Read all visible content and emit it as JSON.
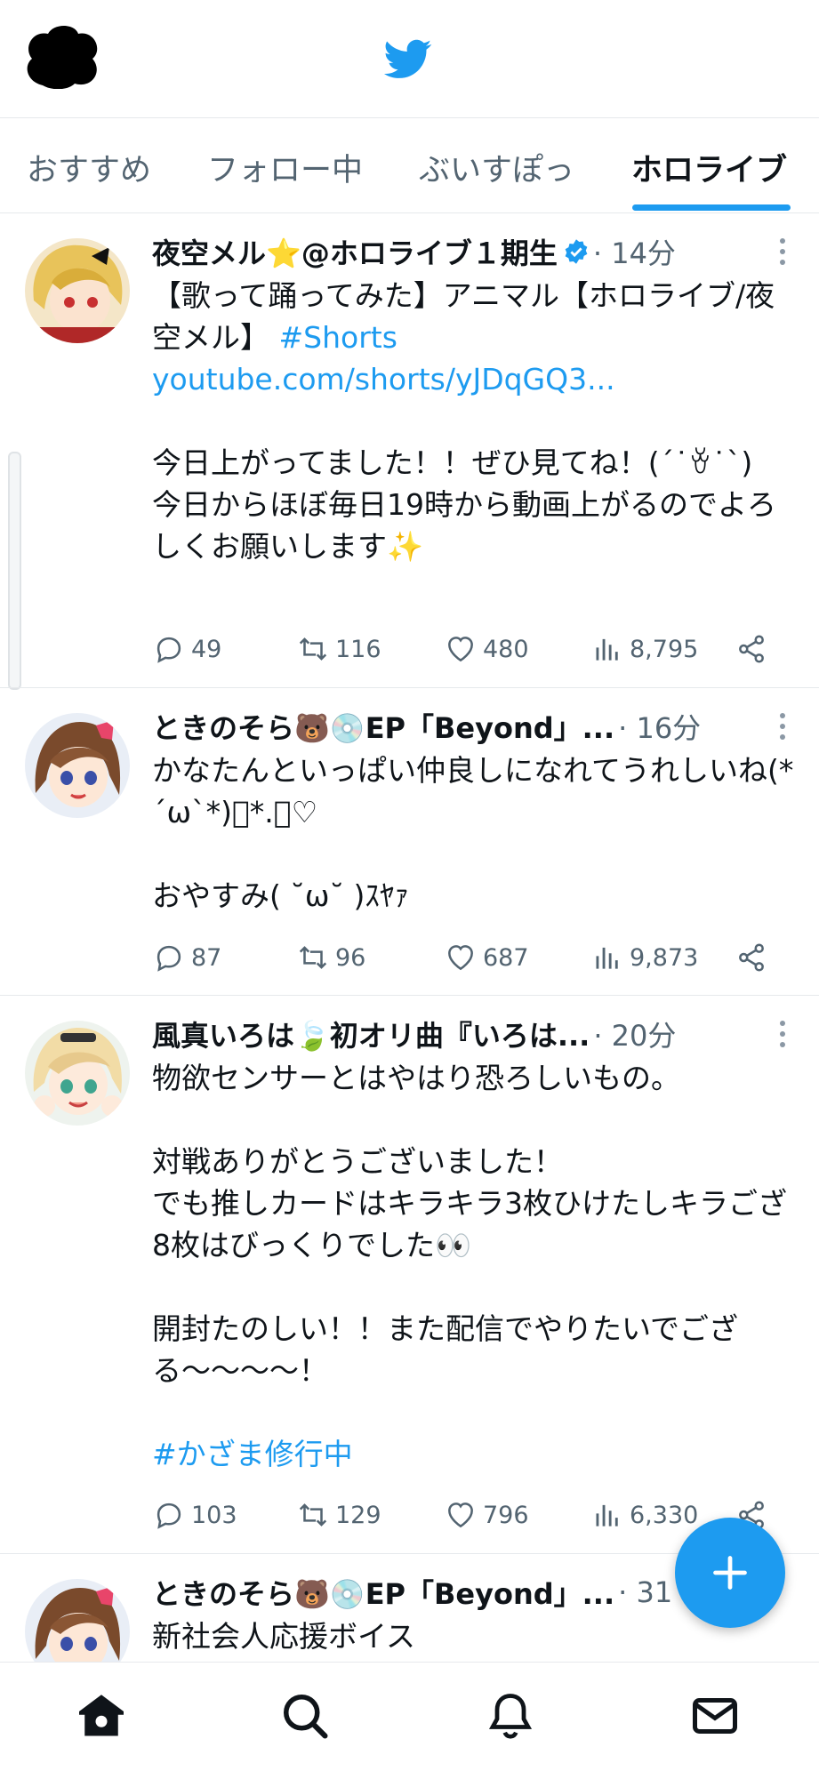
{
  "header": {
    "logo_icon": "twitter-bird-icon",
    "accent": "#1d9bf0"
  },
  "tabs": [
    {
      "label": "おすすめ",
      "active": false
    },
    {
      "label": "フォロー中",
      "active": false
    },
    {
      "label": "ぶいすぽっ",
      "active": false
    },
    {
      "label": "ホロライブ",
      "active": true
    }
  ],
  "tweets": [
    {
      "name": "夜空メル⭐@ホロライブ１期生",
      "verified": true,
      "meta": "· 14分",
      "body": {
        "line1": "【歌って踊ってみた】アニマル【ホロライブ/夜空メル】",
        "hashtag": "#Shorts",
        "link": "youtube.com/shorts/yJDqGQ3...",
        "para2": "今日上がってました！！ぜひ見てね！(ˊ˙ꈊ˙ˋ)",
        "para3": "今日からほぼ毎日19時から動画上がるのでよろしくお願いします✨"
      },
      "replies": "49",
      "retweets": "116",
      "likes": "480",
      "views": "8,795"
    },
    {
      "name": "ときのそら🐻💿EP「Beyond」...",
      "verified": false,
      "meta": "· 16分",
      "body": {
        "para1": "かなたんといっぱい仲良しになれてうれしいね(*´ω`*)ﾟ*.・♡",
        "para2": "おやすみ( ˘ω˘ )ｽﾔｧ"
      },
      "replies": "87",
      "retweets": "96",
      "likes": "687",
      "views": "9,873"
    },
    {
      "name": "風真いろは🍃初オリ曲『いろは...",
      "verified": false,
      "meta": "· 20分",
      "body": {
        "para1": "物欲センサーとはやはり恐ろしいもの。",
        "para2a": "対戦ありがとうございました！",
        "para2b": "でも推しカードはキラキラ3枚ひけたしキラござ8枚はびっくりでした👀",
        "para3": "開封たのしい！！また配信でやりたいでござる〜〜〜〜！",
        "hashtag": "#かざま修行中"
      },
      "replies": "103",
      "retweets": "129",
      "likes": "796",
      "views": "6,330"
    },
    {
      "name": "ときのそら🐻💿EP「Beyond」...",
      "verified": false,
      "meta": "· 31",
      "body": {
        "para1": "新社会人応援ボイス"
      }
    }
  ],
  "fab": {
    "icon": "plus-icon"
  },
  "bottom_nav": [
    {
      "icon": "home-icon"
    },
    {
      "icon": "search-icon"
    },
    {
      "icon": "bell-icon"
    },
    {
      "icon": "mail-icon"
    }
  ]
}
